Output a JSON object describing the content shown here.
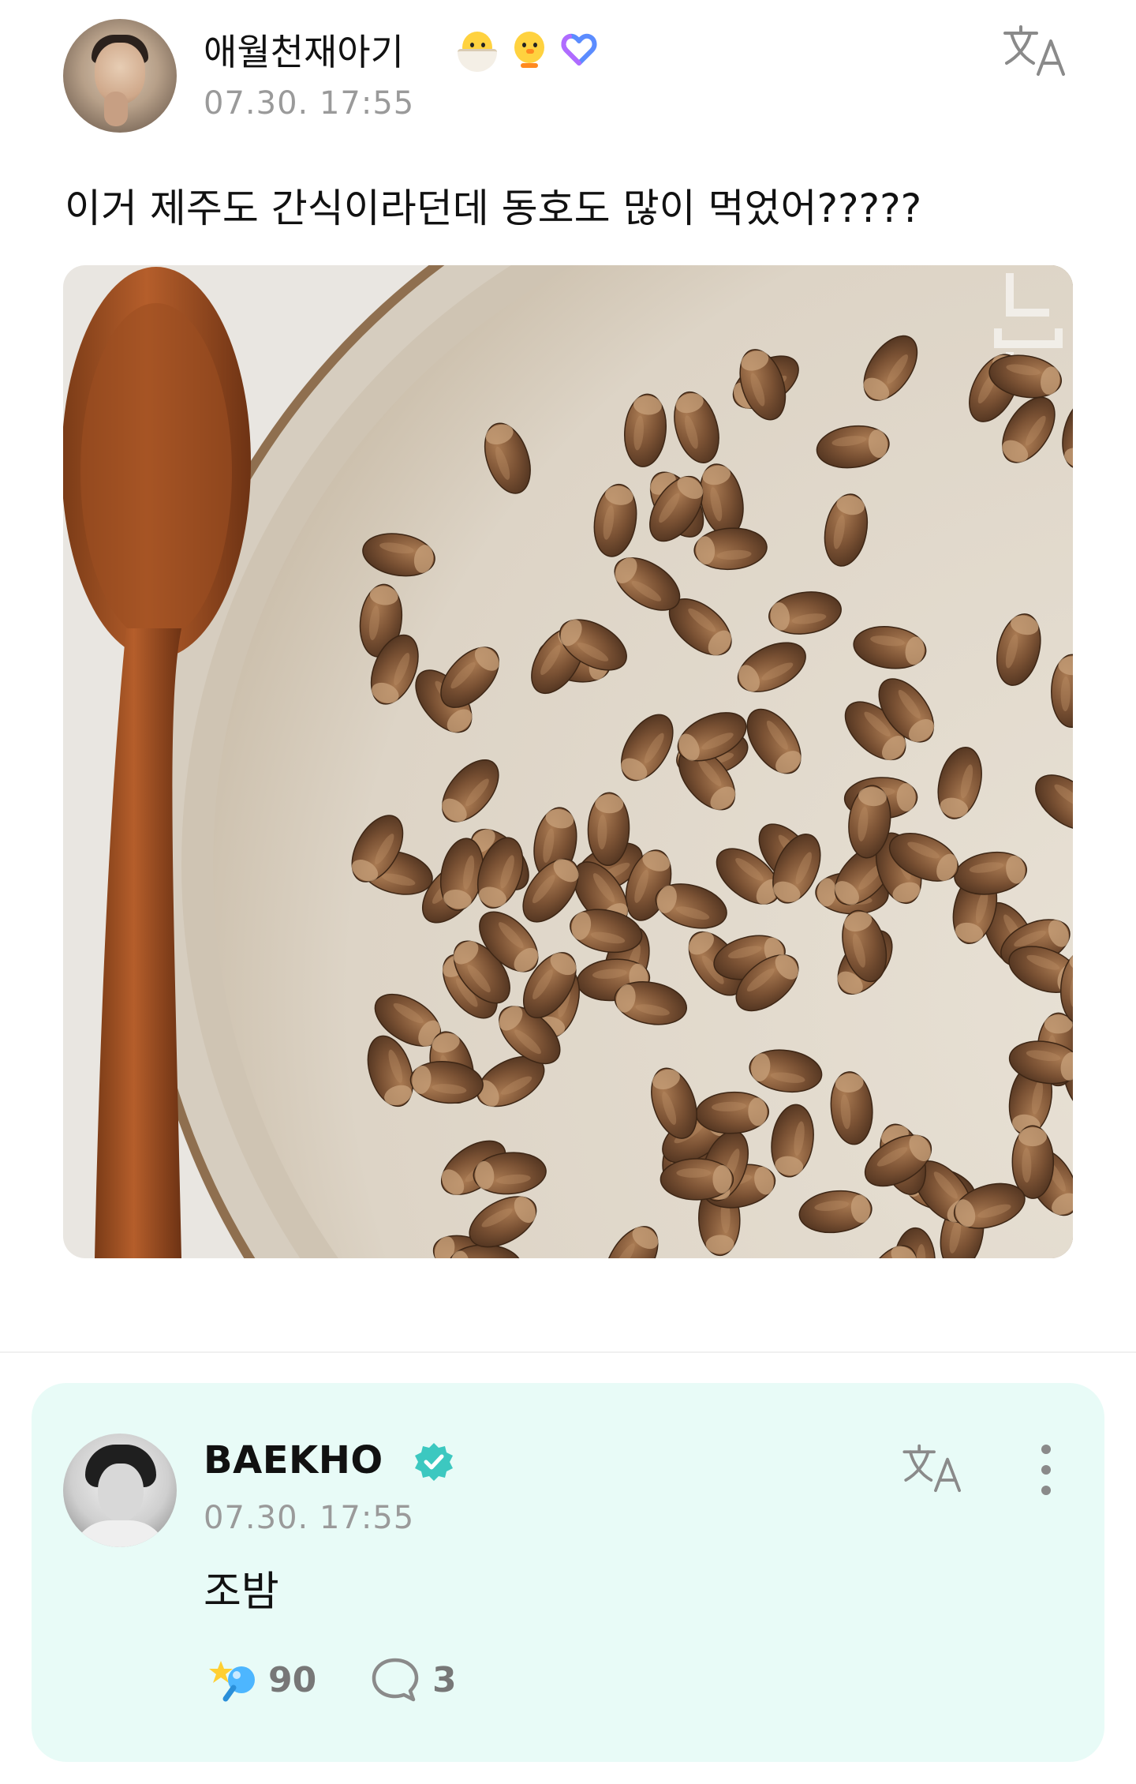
{
  "post": {
    "author": "애월천재아기",
    "badges": [
      "hatching-chick-emoji",
      "chick-emoji",
      "heart-badge-icon"
    ],
    "time": "07.30. 17:55",
    "text": "이거 제주도 간식이라던데 동호도 많이 먹었어?????",
    "photo": "wooden-spoon-and-bowl-of-nuts"
  },
  "comment": {
    "author": "BAEKHO",
    "verified": true,
    "time": "07.30. 17:55",
    "text": "조밤",
    "reaction_count": "90",
    "reply_count": "3"
  },
  "colors": {
    "comment_bg": "#e8fbf7",
    "verified": "#3cc8c0",
    "muted_text": "#9a9a9a"
  }
}
